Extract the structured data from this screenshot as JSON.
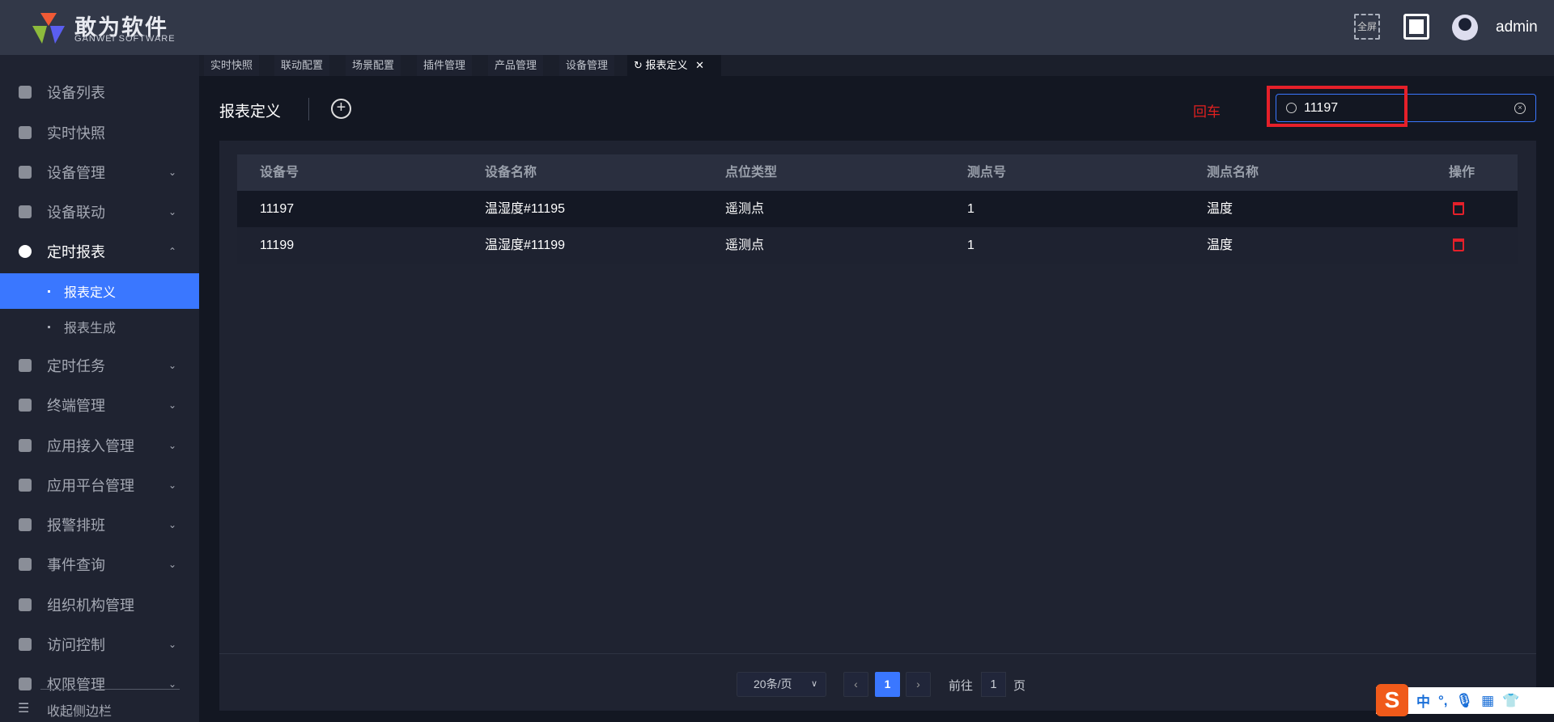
{
  "header": {
    "brand": "敢为软件",
    "brand_sub": "GANWEI SOFTWARE",
    "fullscreen_label": "全屏",
    "username": "admin"
  },
  "sidebar": {
    "items": [
      {
        "label": "设备列表",
        "icon": "monitor-icon"
      },
      {
        "label": "实时快照",
        "icon": "camera-icon"
      },
      {
        "label": "设备管理",
        "icon": "grid-icon",
        "chevron": "⌄"
      },
      {
        "label": "设备联动",
        "icon": "link-icon",
        "chevron": "⌄"
      },
      {
        "label": "定时报表",
        "icon": "clock-icon",
        "chevron": "⌃"
      },
      {
        "label": "定时任务",
        "icon": "task-icon",
        "chevron": "⌄"
      },
      {
        "label": "终端管理",
        "icon": "grid-icon",
        "chevron": "⌄"
      },
      {
        "label": "应用接入管理",
        "icon": "grid-icon",
        "chevron": "⌄"
      },
      {
        "label": "应用平台管理",
        "icon": "grid-icon",
        "chevron": "⌄"
      },
      {
        "label": "报警排班",
        "icon": "calendar-icon",
        "chevron": "⌄"
      },
      {
        "label": "事件查询",
        "icon": "search-doc-icon",
        "chevron": "⌄"
      },
      {
        "label": "组织机构管理",
        "icon": "gear-icon"
      },
      {
        "label": "访问控制",
        "icon": "door-icon",
        "chevron": "⌄"
      },
      {
        "label": "权限管理",
        "icon": "key-icon",
        "chevron": "⌄"
      }
    ],
    "subitems": [
      "报表定义",
      "报表生成"
    ],
    "collapse_label": "收起侧边栏"
  },
  "tabs": [
    "实时快照",
    "联动配置",
    "场景配置",
    "插件管理",
    "产品管理",
    "设备管理",
    "报表定义"
  ],
  "page": {
    "title": "报表定义",
    "enter_hint": "回车",
    "search_value": "11197"
  },
  "table": {
    "columns": [
      "设备号",
      "设备名称",
      "点位类型",
      "测点号",
      "测点名称",
      "操作"
    ],
    "rows": [
      [
        "11197",
        "温湿度#11195",
        "遥测点",
        "1",
        "温度"
      ],
      [
        "11199",
        "温湿度#11199",
        "遥测点",
        "1",
        "温度"
      ]
    ]
  },
  "pagination": {
    "page_size": "20条/页",
    "current_page": "1",
    "goto_label": "前往",
    "goto_value": "1",
    "page_suffix": "页"
  },
  "ime": {
    "lang": "中",
    "punct": "°,"
  }
}
